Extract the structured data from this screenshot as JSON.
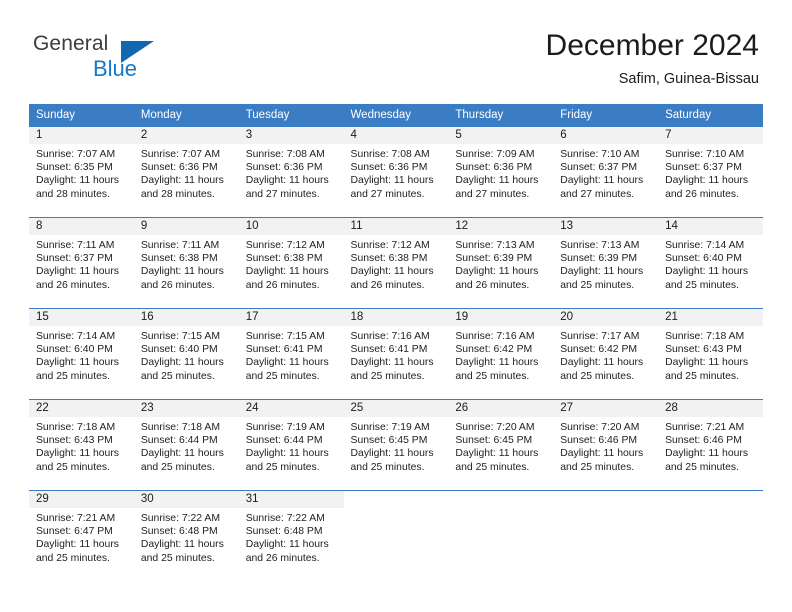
{
  "brand": {
    "name_top": "General",
    "name_bottom": "Blue",
    "triangle_color": "#1267b2",
    "blue_color": "#1578c8"
  },
  "header": {
    "title": "December 2024",
    "subtitle": "Safim, Guinea-Bissau"
  },
  "theme": {
    "header_row_bg": "#3b7dc4",
    "header_row_text": "#ffffff",
    "daynum_strip_bg": "#f2f2f2",
    "row_divider": "#3b7dc4",
    "body_text": "#222222"
  },
  "weekday_headers": [
    "Sunday",
    "Monday",
    "Tuesday",
    "Wednesday",
    "Thursday",
    "Friday",
    "Saturday"
  ],
  "labels": {
    "sunrise_prefix": "Sunrise:",
    "sunset_prefix": "Sunset:",
    "daylight_prefix": "Daylight:"
  },
  "weeks": [
    [
      {
        "day": "1",
        "sunrise": "Sunrise: 7:07 AM",
        "sunset": "Sunset: 6:35 PM",
        "daylight1": "Daylight: 11 hours",
        "daylight2": "and 28 minutes."
      },
      {
        "day": "2",
        "sunrise": "Sunrise: 7:07 AM",
        "sunset": "Sunset: 6:36 PM",
        "daylight1": "Daylight: 11 hours",
        "daylight2": "and 28 minutes."
      },
      {
        "day": "3",
        "sunrise": "Sunrise: 7:08 AM",
        "sunset": "Sunset: 6:36 PM",
        "daylight1": "Daylight: 11 hours",
        "daylight2": "and 27 minutes."
      },
      {
        "day": "4",
        "sunrise": "Sunrise: 7:08 AM",
        "sunset": "Sunset: 6:36 PM",
        "daylight1": "Daylight: 11 hours",
        "daylight2": "and 27 minutes."
      },
      {
        "day": "5",
        "sunrise": "Sunrise: 7:09 AM",
        "sunset": "Sunset: 6:36 PM",
        "daylight1": "Daylight: 11 hours",
        "daylight2": "and 27 minutes."
      },
      {
        "day": "6",
        "sunrise": "Sunrise: 7:10 AM",
        "sunset": "Sunset: 6:37 PM",
        "daylight1": "Daylight: 11 hours",
        "daylight2": "and 27 minutes."
      },
      {
        "day": "7",
        "sunrise": "Sunrise: 7:10 AM",
        "sunset": "Sunset: 6:37 PM",
        "daylight1": "Daylight: 11 hours",
        "daylight2": "and 26 minutes."
      }
    ],
    [
      {
        "day": "8",
        "sunrise": "Sunrise: 7:11 AM",
        "sunset": "Sunset: 6:37 PM",
        "daylight1": "Daylight: 11 hours",
        "daylight2": "and 26 minutes."
      },
      {
        "day": "9",
        "sunrise": "Sunrise: 7:11 AM",
        "sunset": "Sunset: 6:38 PM",
        "daylight1": "Daylight: 11 hours",
        "daylight2": "and 26 minutes."
      },
      {
        "day": "10",
        "sunrise": "Sunrise: 7:12 AM",
        "sunset": "Sunset: 6:38 PM",
        "daylight1": "Daylight: 11 hours",
        "daylight2": "and 26 minutes."
      },
      {
        "day": "11",
        "sunrise": "Sunrise: 7:12 AM",
        "sunset": "Sunset: 6:38 PM",
        "daylight1": "Daylight: 11 hours",
        "daylight2": "and 26 minutes."
      },
      {
        "day": "12",
        "sunrise": "Sunrise: 7:13 AM",
        "sunset": "Sunset: 6:39 PM",
        "daylight1": "Daylight: 11 hours",
        "daylight2": "and 26 minutes."
      },
      {
        "day": "13",
        "sunrise": "Sunrise: 7:13 AM",
        "sunset": "Sunset: 6:39 PM",
        "daylight1": "Daylight: 11 hours",
        "daylight2": "and 25 minutes."
      },
      {
        "day": "14",
        "sunrise": "Sunrise: 7:14 AM",
        "sunset": "Sunset: 6:40 PM",
        "daylight1": "Daylight: 11 hours",
        "daylight2": "and 25 minutes."
      }
    ],
    [
      {
        "day": "15",
        "sunrise": "Sunrise: 7:14 AM",
        "sunset": "Sunset: 6:40 PM",
        "daylight1": "Daylight: 11 hours",
        "daylight2": "and 25 minutes."
      },
      {
        "day": "16",
        "sunrise": "Sunrise: 7:15 AM",
        "sunset": "Sunset: 6:40 PM",
        "daylight1": "Daylight: 11 hours",
        "daylight2": "and 25 minutes."
      },
      {
        "day": "17",
        "sunrise": "Sunrise: 7:15 AM",
        "sunset": "Sunset: 6:41 PM",
        "daylight1": "Daylight: 11 hours",
        "daylight2": "and 25 minutes."
      },
      {
        "day": "18",
        "sunrise": "Sunrise: 7:16 AM",
        "sunset": "Sunset: 6:41 PM",
        "daylight1": "Daylight: 11 hours",
        "daylight2": "and 25 minutes."
      },
      {
        "day": "19",
        "sunrise": "Sunrise: 7:16 AM",
        "sunset": "Sunset: 6:42 PM",
        "daylight1": "Daylight: 11 hours",
        "daylight2": "and 25 minutes."
      },
      {
        "day": "20",
        "sunrise": "Sunrise: 7:17 AM",
        "sunset": "Sunset: 6:42 PM",
        "daylight1": "Daylight: 11 hours",
        "daylight2": "and 25 minutes."
      },
      {
        "day": "21",
        "sunrise": "Sunrise: 7:18 AM",
        "sunset": "Sunset: 6:43 PM",
        "daylight1": "Daylight: 11 hours",
        "daylight2": "and 25 minutes."
      }
    ],
    [
      {
        "day": "22",
        "sunrise": "Sunrise: 7:18 AM",
        "sunset": "Sunset: 6:43 PM",
        "daylight1": "Daylight: 11 hours",
        "daylight2": "and 25 minutes."
      },
      {
        "day": "23",
        "sunrise": "Sunrise: 7:18 AM",
        "sunset": "Sunset: 6:44 PM",
        "daylight1": "Daylight: 11 hours",
        "daylight2": "and 25 minutes."
      },
      {
        "day": "24",
        "sunrise": "Sunrise: 7:19 AM",
        "sunset": "Sunset: 6:44 PM",
        "daylight1": "Daylight: 11 hours",
        "daylight2": "and 25 minutes."
      },
      {
        "day": "25",
        "sunrise": "Sunrise: 7:19 AM",
        "sunset": "Sunset: 6:45 PM",
        "daylight1": "Daylight: 11 hours",
        "daylight2": "and 25 minutes."
      },
      {
        "day": "26",
        "sunrise": "Sunrise: 7:20 AM",
        "sunset": "Sunset: 6:45 PM",
        "daylight1": "Daylight: 11 hours",
        "daylight2": "and 25 minutes."
      },
      {
        "day": "27",
        "sunrise": "Sunrise: 7:20 AM",
        "sunset": "Sunset: 6:46 PM",
        "daylight1": "Daylight: 11 hours",
        "daylight2": "and 25 minutes."
      },
      {
        "day": "28",
        "sunrise": "Sunrise: 7:21 AM",
        "sunset": "Sunset: 6:46 PM",
        "daylight1": "Daylight: 11 hours",
        "daylight2": "and 25 minutes."
      }
    ],
    [
      {
        "day": "29",
        "sunrise": "Sunrise: 7:21 AM",
        "sunset": "Sunset: 6:47 PM",
        "daylight1": "Daylight: 11 hours",
        "daylight2": "and 25 minutes."
      },
      {
        "day": "30",
        "sunrise": "Sunrise: 7:22 AM",
        "sunset": "Sunset: 6:48 PM",
        "daylight1": "Daylight: 11 hours",
        "daylight2": "and 25 minutes."
      },
      {
        "day": "31",
        "sunrise": "Sunrise: 7:22 AM",
        "sunset": "Sunset: 6:48 PM",
        "daylight1": "Daylight: 11 hours",
        "daylight2": "and 26 minutes."
      },
      {
        "day": "",
        "sunrise": "",
        "sunset": "",
        "daylight1": "",
        "daylight2": ""
      },
      {
        "day": "",
        "sunrise": "",
        "sunset": "",
        "daylight1": "",
        "daylight2": ""
      },
      {
        "day": "",
        "sunrise": "",
        "sunset": "",
        "daylight1": "",
        "daylight2": ""
      },
      {
        "day": "",
        "sunrise": "",
        "sunset": "",
        "daylight1": "",
        "daylight2": ""
      }
    ]
  ]
}
